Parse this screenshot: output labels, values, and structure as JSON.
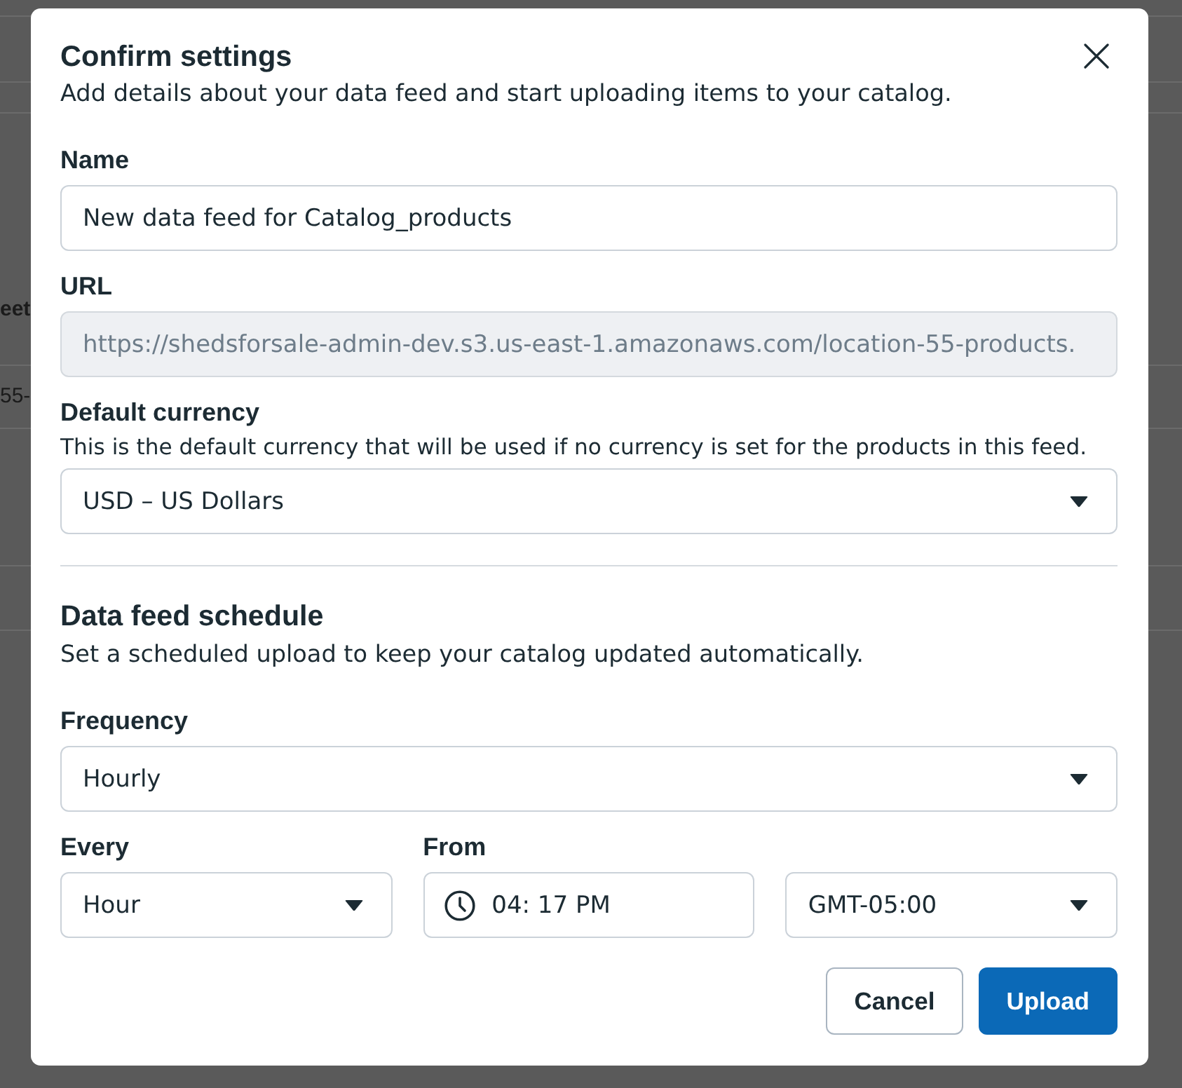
{
  "background": {
    "fragments": [
      {
        "kind": "heading",
        "text": "eet"
      },
      {
        "kind": "cell",
        "text": "55-"
      }
    ]
  },
  "dialog": {
    "title": "Confirm settings",
    "subtitle": "Add details about your data feed and start uploading items to your catalog."
  },
  "fields": [
    {
      "kind": "text",
      "label": "Name",
      "value": "New data feed for Catalog_products",
      "disabled": false
    },
    {
      "kind": "text",
      "label": "URL",
      "value": "https://shedsforsale-admin-dev.s3.us-east-1.amazonaws.com/location-55-products.",
      "disabled": true
    },
    {
      "kind": "select",
      "label": "Default currency",
      "help": "This is the default currency that will be used if no currency is set for the products in this feed.",
      "value": "USD – US Dollars"
    }
  ],
  "schedule": {
    "title": "Data feed schedule",
    "subtitle": "Set a scheduled upload to keep your catalog updated automatically.",
    "frequency": {
      "label": "Frequency",
      "value": "Hourly"
    },
    "row": [
      {
        "kind": "select",
        "label": "Every",
        "value": "Hour"
      },
      {
        "kind": "time",
        "label": "From",
        "value": "04: 17 PM"
      },
      {
        "kind": "select",
        "value": "GMT-05:00"
      }
    ]
  },
  "buttons": [
    {
      "kind": "secondary",
      "label": "Cancel"
    },
    {
      "kind": "primary",
      "label": "Upload"
    }
  ]
}
